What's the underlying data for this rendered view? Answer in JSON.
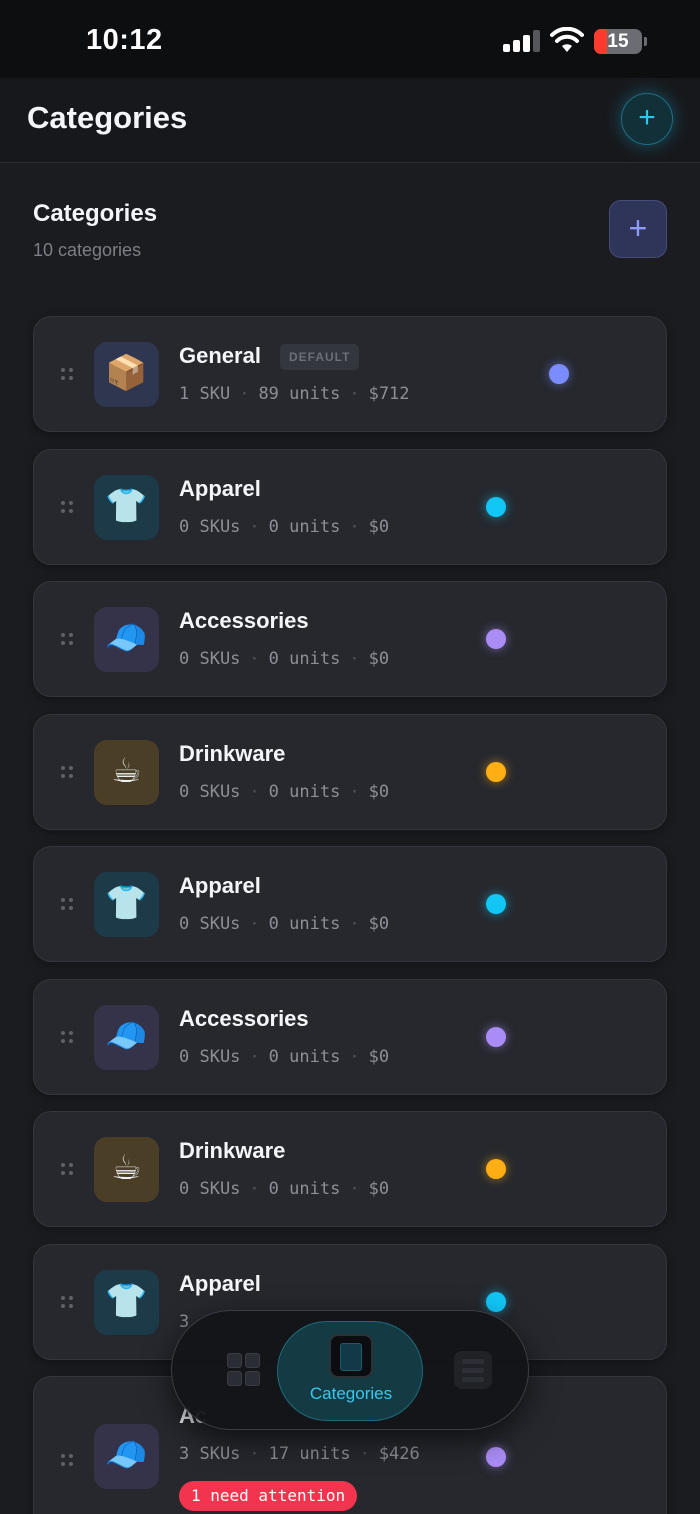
{
  "status_bar": {
    "time": "10:12",
    "battery": "15"
  },
  "nav": {
    "title": "Categories",
    "add_icon": "+"
  },
  "section": {
    "title": "Categories",
    "subtitle": "10 categories",
    "add_icon": "+"
  },
  "default_badge": "DEFAULT",
  "attention_badge": "1 need attention",
  "categories": [
    {
      "name": "General",
      "emoji": "📦",
      "skus": "1 SKU",
      "units": "89 units",
      "value": "$712",
      "dot_color": "#7b8cff",
      "icon_bg": "#2f3650"
    },
    {
      "name": "Apparel",
      "emoji": "👕",
      "skus": "0 SKUs",
      "units": "0 units",
      "value": "$0",
      "dot_color": "#12c6f5",
      "icon_bg": "#1c3a48"
    },
    {
      "name": "Accessories",
      "emoji": "🧢",
      "skus": "0 SKUs",
      "units": "0 units",
      "value": "$0",
      "dot_color": "#a98cf5",
      "icon_bg": "#353349"
    },
    {
      "name": "Drinkware",
      "emoji": "☕",
      "skus": "0 SKUs",
      "units": "0 units",
      "value": "$0",
      "dot_color": "#ffae14",
      "icon_bg": "#4a3e26"
    },
    {
      "name": "Apparel",
      "emoji": "👕",
      "skus": "0 SKUs",
      "units": "0 units",
      "value": "$0",
      "dot_color": "#12c6f5",
      "icon_bg": "#1c3a48"
    },
    {
      "name": "Accessories",
      "emoji": "🧢",
      "skus": "0 SKUs",
      "units": "0 units",
      "value": "$0",
      "dot_color": "#a98cf5",
      "icon_bg": "#353349"
    },
    {
      "name": "Drinkware",
      "emoji": "☕",
      "skus": "0 SKUs",
      "units": "0 units",
      "value": "$0",
      "dot_color": "#ffae14",
      "icon_bg": "#4a3e26"
    },
    {
      "name": "Apparel",
      "emoji": "👕",
      "skus": "3",
      "units": "",
      "value": "",
      "dot_color": "#12c6f5",
      "icon_bg": "#1c3a48"
    },
    {
      "name": "Ac",
      "emoji": "🧢",
      "skus": "3 SKUs",
      "units": "17 units",
      "value": "$426",
      "dot_color": "#a98cf5",
      "icon_bg": "#353349"
    }
  ],
  "tab_bar": {
    "active_label": "Categories",
    "tabs": [
      "dashboard-grid-icon",
      "categories-folder-icon",
      "list-icon"
    ]
  }
}
